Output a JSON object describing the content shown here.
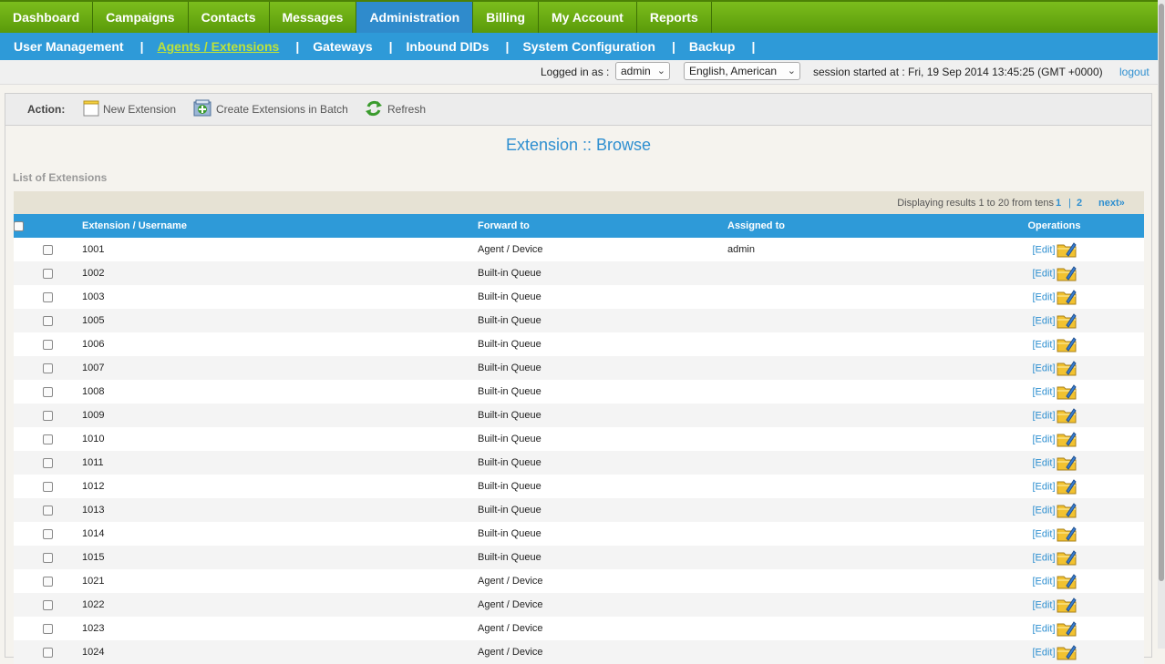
{
  "top_nav": [
    {
      "label": "Dashboard",
      "active": false
    },
    {
      "label": "Campaigns",
      "active": false
    },
    {
      "label": "Contacts",
      "active": false
    },
    {
      "label": "Messages",
      "active": false
    },
    {
      "label": "Administration",
      "active": true
    },
    {
      "label": "Billing",
      "active": false
    },
    {
      "label": "My Account",
      "active": false
    },
    {
      "label": "Reports",
      "active": false
    }
  ],
  "sub_nav": [
    {
      "label": "User Management",
      "active": false
    },
    {
      "label": "Agents / Extensions",
      "active": true
    },
    {
      "label": "Gateways",
      "active": false
    },
    {
      "label": "Inbound DIDs",
      "active": false
    },
    {
      "label": "System Configuration",
      "active": false
    },
    {
      "label": "Backup",
      "active": false
    }
  ],
  "session": {
    "logged_in_label": "Logged in as :",
    "user_value": "admin",
    "language_value": "English, American",
    "session_text": "session started at : Fri, 19 Sep 2014 13:45:25 (GMT +0000)",
    "logout_label": "logout"
  },
  "actions": {
    "label": "Action:",
    "new_extension": "New Extension",
    "create_batch": "Create Extensions in Batch",
    "refresh": "Refresh"
  },
  "page_title": "Extension :: Browse",
  "list_title": "List of Extensions",
  "pager": {
    "display_text": "Displaying results 1 to 20 from tens",
    "pages": [
      "1",
      "2"
    ],
    "separator": "|",
    "next": "next»"
  },
  "table": {
    "columns": [
      "Extension / Username",
      "Forward to",
      "Assigned to",
      "Operations"
    ],
    "edit_label": "[Edit]",
    "rows": [
      {
        "ext": "1001",
        "forward": "Agent / Device",
        "assigned": "admin"
      },
      {
        "ext": "1002",
        "forward": "Built-in Queue",
        "assigned": ""
      },
      {
        "ext": "1003",
        "forward": "Built-in Queue",
        "assigned": ""
      },
      {
        "ext": "1005",
        "forward": "Built-in Queue",
        "assigned": ""
      },
      {
        "ext": "1006",
        "forward": "Built-in Queue",
        "assigned": ""
      },
      {
        "ext": "1007",
        "forward": "Built-in Queue",
        "assigned": ""
      },
      {
        "ext": "1008",
        "forward": "Built-in Queue",
        "assigned": ""
      },
      {
        "ext": "1009",
        "forward": "Built-in Queue",
        "assigned": ""
      },
      {
        "ext": "1010",
        "forward": "Built-in Queue",
        "assigned": ""
      },
      {
        "ext": "1011",
        "forward": "Built-in Queue",
        "assigned": ""
      },
      {
        "ext": "1012",
        "forward": "Built-in Queue",
        "assigned": ""
      },
      {
        "ext": "1013",
        "forward": "Built-in Queue",
        "assigned": ""
      },
      {
        "ext": "1014",
        "forward": "Built-in Queue",
        "assigned": ""
      },
      {
        "ext": "1015",
        "forward": "Built-in Queue",
        "assigned": ""
      },
      {
        "ext": "1021",
        "forward": "Agent / Device",
        "assigned": ""
      },
      {
        "ext": "1022",
        "forward": "Agent / Device",
        "assigned": ""
      },
      {
        "ext": "1023",
        "forward": "Agent / Device",
        "assigned": ""
      },
      {
        "ext": "1024",
        "forward": "Agent / Device",
        "assigned": ""
      }
    ]
  },
  "colors": {
    "nav_green": "#6aae12",
    "nav_active_blue": "#2f8bcc",
    "subnav_blue": "#2e9ad8",
    "subnav_active_text": "#bde23a",
    "link_blue": "#2e8fd0"
  }
}
